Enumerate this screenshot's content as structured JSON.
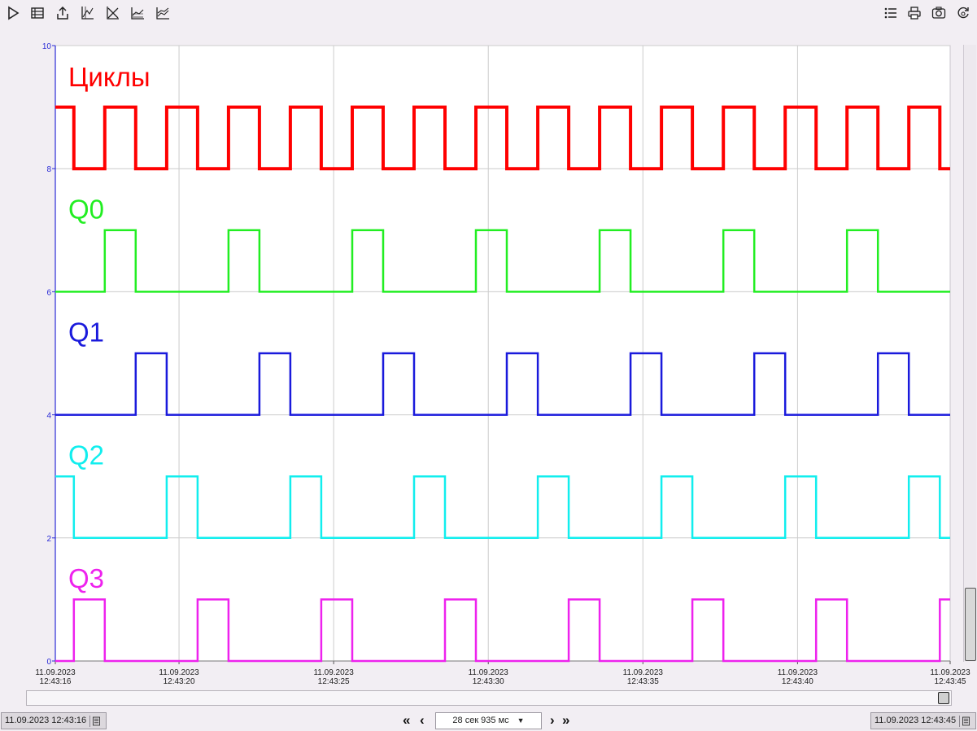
{
  "toolbar": {
    "left_icons": [
      "play-icon",
      "table-icon",
      "export-icon",
      "axes-icon",
      "axes-cross-icon",
      "chart-area-icon",
      "chart-line-icon"
    ],
    "right_icons": [
      "list-icon",
      "print-icon",
      "camera-icon",
      "refresh-icon"
    ]
  },
  "chart_data": {
    "type": "line",
    "xlim_seconds": [
      0,
      28.935
    ],
    "ylim": [
      0,
      10
    ],
    "y_ticks": [
      "0",
      "2",
      "4",
      "6",
      "8",
      "10"
    ],
    "x_ticks": [
      {
        "t": 0,
        "date": "11.09.2023",
        "time": "12:43:16"
      },
      {
        "t": 4,
        "date": "11.09.2023",
        "time": "12:43:20"
      },
      {
        "t": 9,
        "date": "11.09.2023",
        "time": "12:43:25"
      },
      {
        "t": 14,
        "date": "11.09.2023",
        "time": "12:43:30"
      },
      {
        "t": 19,
        "date": "11.09.2023",
        "time": "12:43:35"
      },
      {
        "t": 24,
        "date": "11.09.2023",
        "time": "12:43:40"
      },
      {
        "t": 28.935,
        "date": "11.09.2023",
        "time": "12:43:45"
      }
    ],
    "grid": true,
    "series": [
      {
        "name": "Циклы",
        "color": "#ff0000",
        "width": 4,
        "low": 8,
        "high": 9,
        "label_y": 9.5,
        "x": [
          0,
          0.6,
          0.6,
          1.6,
          1.6,
          2.6,
          2.6,
          3.6,
          3.6,
          4.6,
          4.6,
          5.6,
          5.6,
          6.6,
          6.6,
          7.6,
          7.6,
          8.6,
          8.6,
          9.6,
          9.6,
          10.6,
          10.6,
          11.6,
          11.6,
          12.6,
          12.6,
          13.6,
          13.6,
          14.6,
          14.6,
          15.6,
          15.6,
          16.6,
          16.6,
          17.6,
          17.6,
          18.6,
          18.6,
          19.6,
          19.6,
          20.6,
          20.6,
          21.6,
          21.6,
          22.6,
          22.6,
          23.6,
          23.6,
          24.6,
          24.6,
          25.6,
          25.6,
          26.6,
          26.6,
          27.6,
          27.6,
          28.6,
          28.6,
          28.935
        ],
        "values": [
          9,
          9,
          8,
          8,
          9,
          9,
          8,
          8,
          9,
          9,
          8,
          8,
          9,
          9,
          8,
          8,
          9,
          9,
          8,
          8,
          9,
          9,
          8,
          8,
          9,
          9,
          8,
          8,
          9,
          9,
          8,
          8,
          9,
          9,
          8,
          8,
          9,
          9,
          8,
          8,
          9,
          9,
          8,
          8,
          9,
          9,
          8,
          8,
          9,
          9,
          8,
          8,
          9,
          9,
          8,
          8,
          9,
          9,
          8,
          8
        ]
      },
      {
        "name": "Q0",
        "color": "#22ee22",
        "width": 2.5,
        "low": 6,
        "high": 7,
        "label_y": 7.35,
        "x": [
          0,
          1.6,
          1.6,
          2.6,
          2.6,
          5.6,
          5.6,
          6.6,
          6.6,
          9.6,
          9.6,
          10.6,
          10.6,
          13.6,
          13.6,
          14.6,
          14.6,
          17.6,
          17.6,
          18.6,
          18.6,
          21.6,
          21.6,
          22.6,
          22.6,
          25.6,
          25.6,
          26.6,
          26.6,
          28.935
        ],
        "values": [
          6,
          6,
          7,
          7,
          6,
          6,
          7,
          7,
          6,
          6,
          7,
          7,
          6,
          6,
          7,
          7,
          6,
          6,
          7,
          7,
          6,
          6,
          7,
          7,
          6,
          6,
          7,
          7,
          6,
          6
        ]
      },
      {
        "name": "Q1",
        "color": "#1a1adc",
        "width": 2.5,
        "low": 4,
        "high": 5,
        "label_y": 5.35,
        "x": [
          0,
          2.6,
          2.6,
          3.6,
          3.6,
          6.6,
          6.6,
          7.6,
          7.6,
          10.6,
          10.6,
          11.6,
          11.6,
          14.6,
          14.6,
          15.6,
          15.6,
          18.6,
          18.6,
          19.6,
          19.6,
          22.6,
          22.6,
          23.6,
          23.6,
          26.6,
          26.6,
          27.6,
          27.6,
          28.935
        ],
        "values": [
          4,
          4,
          5,
          5,
          4,
          4,
          5,
          5,
          4,
          4,
          5,
          5,
          4,
          4,
          5,
          5,
          4,
          4,
          5,
          5,
          4,
          4,
          5,
          5,
          4,
          4,
          5,
          5,
          4,
          4
        ]
      },
      {
        "name": "Q2",
        "color": "#11eeee",
        "width": 2.5,
        "low": 2,
        "high": 3,
        "label_y": 3.35,
        "x": [
          0,
          0.6,
          0.6,
          3.6,
          3.6,
          4.6,
          4.6,
          7.6,
          7.6,
          8.6,
          8.6,
          11.6,
          11.6,
          12.6,
          12.6,
          15.6,
          15.6,
          16.6,
          16.6,
          19.6,
          19.6,
          20.6,
          20.6,
          23.6,
          23.6,
          24.6,
          24.6,
          27.6,
          27.6,
          28.6,
          28.6,
          28.935
        ],
        "values": [
          3,
          3,
          2,
          2,
          3,
          3,
          2,
          2,
          3,
          3,
          2,
          2,
          3,
          3,
          2,
          2,
          3,
          3,
          2,
          2,
          3,
          3,
          2,
          2,
          3,
          3,
          2,
          2,
          3,
          3,
          2,
          2
        ]
      },
      {
        "name": "Q3",
        "color": "#ee22ee",
        "width": 2.5,
        "low": 0,
        "high": 1,
        "label_y": 1.35,
        "x": [
          0,
          0.6,
          0.6,
          1.6,
          1.6,
          4.6,
          4.6,
          5.6,
          5.6,
          8.6,
          8.6,
          9.6,
          9.6,
          12.6,
          12.6,
          13.6,
          13.6,
          16.6,
          16.6,
          17.6,
          17.6,
          20.6,
          20.6,
          21.6,
          21.6,
          24.6,
          24.6,
          25.6,
          25.6,
          28.6,
          28.6,
          28.935
        ],
        "values": [
          0,
          0,
          1,
          1,
          0,
          0,
          1,
          1,
          0,
          0,
          1,
          1,
          0,
          0,
          1,
          1,
          0,
          0,
          1,
          1,
          0,
          0,
          1,
          1,
          0,
          0,
          1,
          1,
          0,
          0,
          1,
          1
        ]
      }
    ]
  },
  "status": {
    "start_datetime": "11.09.2023 12:43:16",
    "end_datetime": "11.09.2023 12:43:45",
    "range_label": "28 сек 935 мс",
    "nav_first": "«",
    "nav_prev": "‹",
    "nav_next": "›",
    "nav_last": "»"
  }
}
